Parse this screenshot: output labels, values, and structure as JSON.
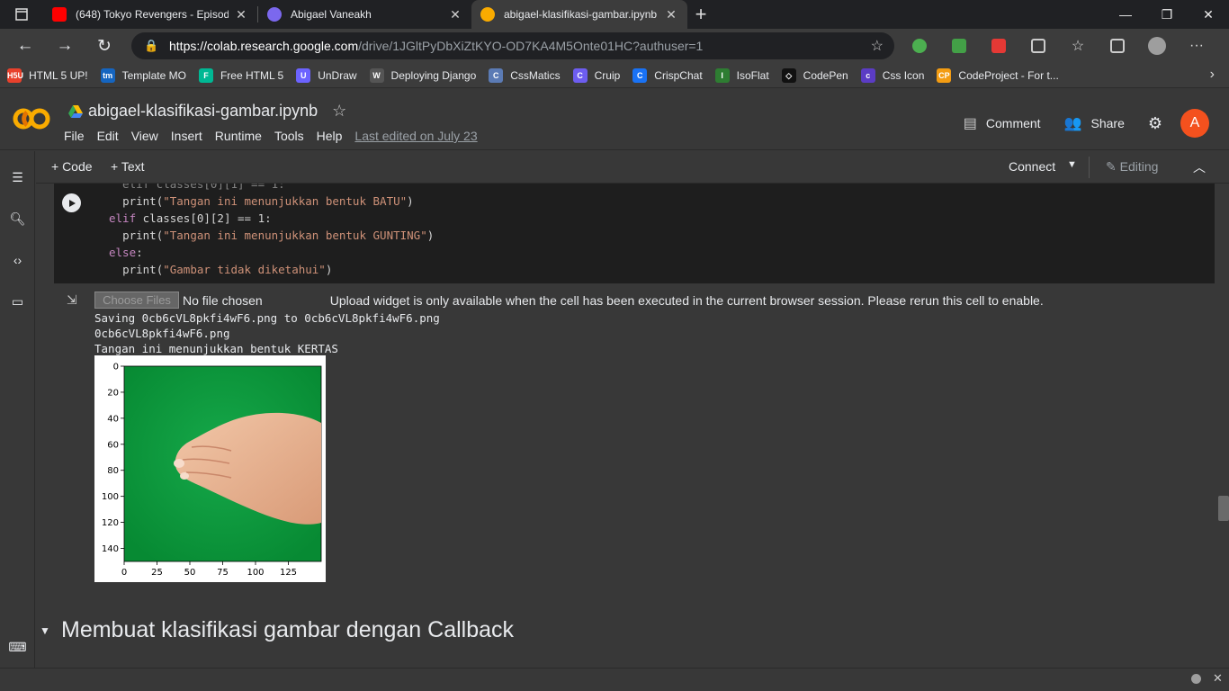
{
  "browser": {
    "tabs": [
      {
        "title": "(648) Tokyo Revengers - Episode",
        "favicon_color": "#ff0000"
      },
      {
        "title": "Abigael Vaneakh",
        "favicon_color": "#7b68ee"
      },
      {
        "title": "abigael-klasifikasi-gambar.ipynb",
        "favicon_color": "#f9ab00"
      }
    ],
    "url_host": "https://colab.research.google.com",
    "url_path": "/drive/1JGltPyDbXiZtKYO-OD7KA4M5Onte01HC?authuser=1"
  },
  "bookmarks": [
    {
      "label": "HTML 5 UP!",
      "icon": "html5up-icon",
      "color": "#e8412c",
      "glyph": "H5U"
    },
    {
      "label": "Template MO",
      "icon": "templatemo-icon",
      "color": "#1565c0",
      "glyph": "tm"
    },
    {
      "label": "Free HTML 5",
      "icon": "freehtml5-icon",
      "color": "#00b894",
      "glyph": "F"
    },
    {
      "label": "UnDraw",
      "icon": "undraw-icon",
      "color": "#6c63ff",
      "glyph": "U"
    },
    {
      "label": "Deploying Django",
      "icon": "wordpress-icon",
      "color": "#555555",
      "glyph": "W"
    },
    {
      "label": "CssMatics",
      "icon": "cssmatics-icon",
      "color": "#5b7bb5",
      "glyph": "C"
    },
    {
      "label": "Cruip",
      "icon": "cruip-icon",
      "color": "#6d5df0",
      "glyph": "C"
    },
    {
      "label": "CrispChat",
      "icon": "crispchat-icon",
      "color": "#1972f5",
      "glyph": "C"
    },
    {
      "label": "IsoFlat",
      "icon": "isoflat-icon",
      "color": "#2e7d32",
      "glyph": "I"
    },
    {
      "label": "CodePen",
      "icon": "codepen-icon",
      "color": "#111111",
      "glyph": "◇"
    },
    {
      "label": "Css Icon",
      "icon": "cssicon-icon",
      "color": "#5b3cc4",
      "glyph": "c"
    },
    {
      "label": "CodeProject - For t...",
      "icon": "codeproject-icon",
      "color": "#f39c12",
      "glyph": "CP"
    }
  ],
  "colab": {
    "notebook_title": "abigael-klasifikasi-gambar.ipynb",
    "menus": [
      "File",
      "Edit",
      "View",
      "Insert",
      "Runtime",
      "Tools",
      "Help"
    ],
    "last_edited": "Last edited on July 23",
    "comment_label": "Comment",
    "share_label": "Share",
    "avatar_letter": "A",
    "avatar_color": "#f4511e"
  },
  "toolbar": {
    "add_code": "+ Code",
    "add_text": "+ Text",
    "connect": "Connect",
    "editing": "Editing"
  },
  "cell": {
    "code_lines": [
      {
        "indent": "  ",
        "kw": "",
        "text": "print(",
        "str": "\"Tangan ini menunjukkan bentuk BATU\"",
        "tail": ")"
      },
      {
        "indent": "",
        "kw": "elif ",
        "text": "classes[0][2] == 1:",
        "str": "",
        "tail": ""
      },
      {
        "indent": "  ",
        "kw": "",
        "text": "print(",
        "str": "\"Tangan ini menunjukkan bentuk GUNTING\"",
        "tail": ")"
      },
      {
        "indent": "",
        "kw": "else",
        "text": ":",
        "str": "",
        "tail": ""
      },
      {
        "indent": "  ",
        "kw": "",
        "text": "print(",
        "str": "\"Gambar tidak diketahui\"",
        "tail": ")"
      }
    ],
    "choose_files": "Choose Files",
    "no_file": "No file chosen",
    "upload_msg": "Upload widget is only available when the cell has been executed in the current browser session. Please rerun this cell to enable.",
    "output_lines": [
      "Saving 0cb6cVL8pkfi4wF6.png to 0cb6cVL8pkfi4wF6.png",
      "0cb6cVL8pkfi4wF6.png",
      "Tangan ini menunjukkan bentuk KERTAS"
    ]
  },
  "plot": {
    "y_ticks": [
      "0",
      "20",
      "40",
      "60",
      "80",
      "100",
      "120",
      "140"
    ],
    "x_ticks": [
      "0",
      "25",
      "50",
      "75",
      "100",
      "125"
    ],
    "image_bg": "#0e9a3c"
  },
  "section_heading": "Membuat klasifikasi gambar dengan Callback"
}
